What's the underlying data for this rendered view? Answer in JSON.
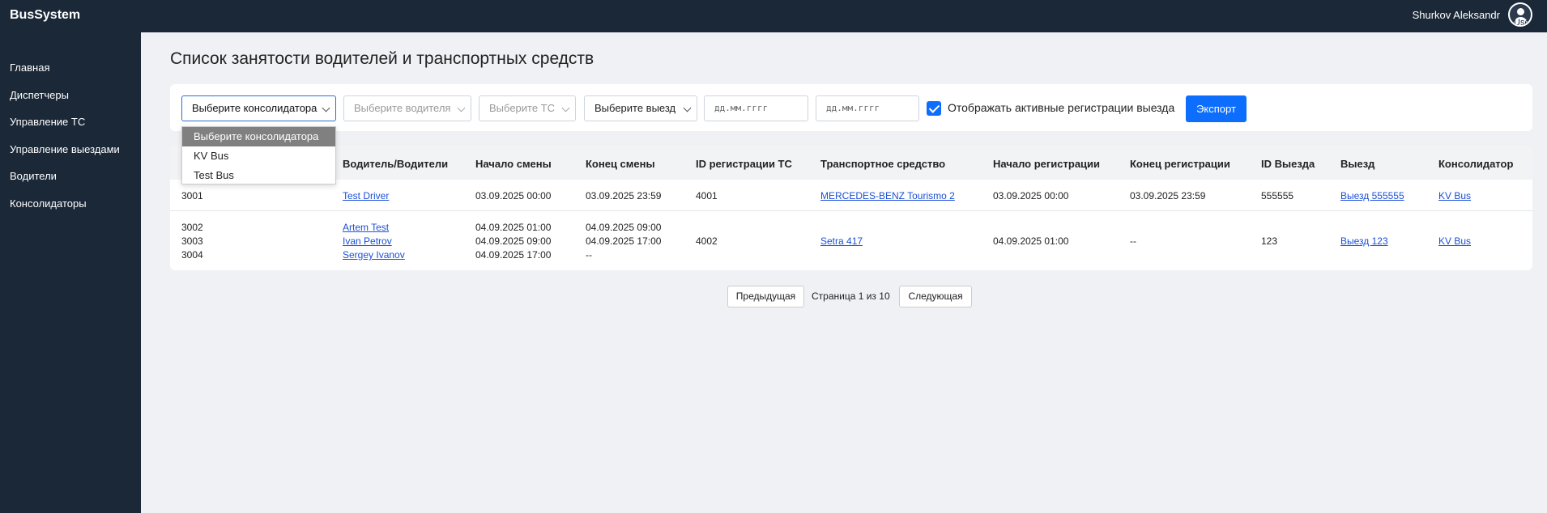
{
  "app": {
    "brand": "BusSystem",
    "user_name": "Shurkov Aleksandr",
    "avatar_alt": "Use"
  },
  "sidebar": {
    "items": [
      {
        "label": "Главная"
      },
      {
        "label": "Диспетчеры"
      },
      {
        "label": "Управление ТС"
      },
      {
        "label": "Управление выездами"
      },
      {
        "label": "Водители"
      },
      {
        "label": "Консолидаторы"
      }
    ]
  },
  "page": {
    "title": "Список занятости водителей и транспортных средств"
  },
  "filters": {
    "consolidator_selected": "Выберите консолидатора",
    "driver_placeholder": "Выберите водителя",
    "vehicle_placeholder": "Выберите ТС",
    "trip_selected": "Выберите выезд",
    "date_from_placeholder": "дд.мм.гггг",
    "date_to_placeholder": "дд.мм.гггг",
    "active_checkbox_label": "Отображать активные регистрации выезда",
    "active_checked": true,
    "export_label": "Экспорт"
  },
  "consolidator_dropdown": {
    "options": [
      "Выберите консолидатора",
      "KV Bus",
      "Test Bus"
    ]
  },
  "table": {
    "columns": [
      "Водитель/Водители",
      "Начало смены",
      "Конец смены",
      "ID регистрации ТС",
      "Транспортное средство",
      "Начало регистрации",
      "Конец регистрации",
      "ID Выезда",
      "Выезд",
      "Консолидатор"
    ],
    "rows": [
      {
        "ids": [
          "3001"
        ],
        "drivers": [
          "Test Driver"
        ],
        "shift_start": [
          "03.09.2025 00:00"
        ],
        "shift_end": [
          "03.09.2025 23:59"
        ],
        "vehicle_reg_id": "4001",
        "vehicle": "MERCEDES-BENZ Tourismo 2",
        "reg_start": "03.09.2025 00:00",
        "reg_end": "03.09.2025 23:59",
        "trip_id": "555555",
        "trip": "Выезд 555555",
        "consolidator": "KV Bus"
      },
      {
        "ids": [
          "3002",
          "3003",
          "3004"
        ],
        "drivers": [
          "Artem Test",
          "Ivan Petrov",
          "Sergey Ivanov"
        ],
        "shift_start": [
          "04.09.2025 01:00",
          "04.09.2025 09:00",
          "04.09.2025 17:00"
        ],
        "shift_end": [
          "04.09.2025 09:00",
          "04.09.2025 17:00",
          "--"
        ],
        "vehicle_reg_id": "4002",
        "vehicle": "Setra 417",
        "reg_start": "04.09.2025 01:00",
        "reg_end": "--",
        "trip_id": "123",
        "trip": "Выезд 123",
        "consolidator": "KV Bus"
      }
    ]
  },
  "pagination": {
    "prev_label": "Предыдущая",
    "status": "Страница 1 из 10",
    "next_label": "Следующая"
  }
}
